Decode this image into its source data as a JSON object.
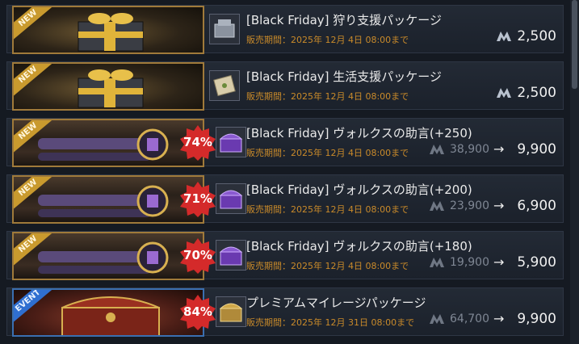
{
  "currency_icon": "mileage-m-icon",
  "arrow": "→",
  "colors": {
    "period": "#c98a2a",
    "badge": "#d42a2a",
    "new_ribbon": "#c99a2e",
    "event_ribbon": "#2f6fd0"
  },
  "items": [
    {
      "ribbon": "NEW",
      "title": "[Black Friday] 狩り支援パッケージ",
      "period": "販売期間：2025年 12月 4日 08:00まで",
      "price": "2,500",
      "thumb_icon": "armor-chest-icon"
    },
    {
      "ribbon": "NEW",
      "title": "[Black Friday] 生活支援パッケージ",
      "period": "販売期間：2025年 12月 4日 08:00まで",
      "price": "2,500",
      "thumb_icon": "scroll-package-icon"
    },
    {
      "ribbon": "NEW",
      "title": "[Black Friday] ヴォルクスの助言(+250)",
      "period": "販売期間：2025年 12月 4日 08:00まで",
      "discount": "74%",
      "old_price": "38,900",
      "new_price": "9,900",
      "thumb_icon": "purple-chest-icon"
    },
    {
      "ribbon": "NEW",
      "title": "[Black Friday] ヴォルクスの助言(+200)",
      "period": "販売期間：2025年 12月 4日 08:00まで",
      "discount": "71%",
      "old_price": "23,900",
      "new_price": "6,900",
      "thumb_icon": "purple-chest-icon"
    },
    {
      "ribbon": "NEW",
      "title": "[Black Friday] ヴォルクスの助言(+180)",
      "period": "販売期間：2025年 12月 4日 08:00まで",
      "discount": "70%",
      "old_price": "19,900",
      "new_price": "5,900",
      "thumb_icon": "purple-chest-icon"
    },
    {
      "ribbon": "EVENT",
      "title": "プレミアムマイレージパッケージ",
      "period": "販売期間：2025年 12月 31日 08:00まで",
      "discount": "84%",
      "old_price": "64,700",
      "new_price": "9,900",
      "thumb_icon": "gold-chest-icon"
    }
  ]
}
